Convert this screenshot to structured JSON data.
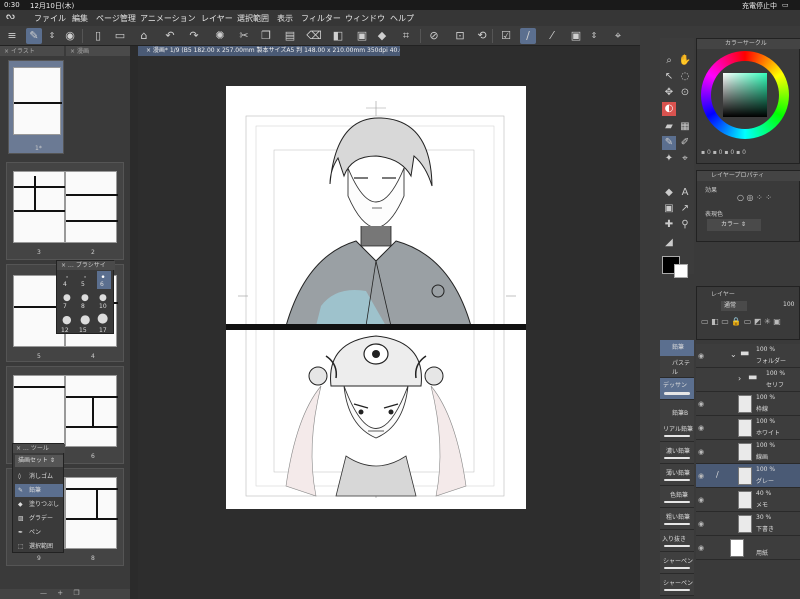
{
  "statusbar": {
    "time": "0:30",
    "date": "12月10日(木)",
    "battery": "充電停止中"
  },
  "menu": [
    "ファイル",
    "編集",
    "ページ管理",
    "アニメーション",
    "レイヤー",
    "選択範囲",
    "表示",
    "フィルター",
    "ウィンドウ",
    "ヘルプ"
  ],
  "pages_panel": {
    "header": "イラスト",
    "header2": "漫画",
    "pages": [
      {
        "label": "1*",
        "selected": true
      },
      {
        "label_left": "3",
        "label_right": "2"
      },
      {
        "label_left": "5",
        "label_right": "4"
      },
      {
        "label_left": "7",
        "label_right": "6"
      },
      {
        "label_left": "9",
        "label_right": "8"
      }
    ]
  },
  "canvas_tab": "× 漫画* 1/9 (B5 182.00 x 257.00mm 製本サイズA5 判 148.00 x 210.00mm 350dpi 40.6%)",
  "brush_size_popup": {
    "title": "ブラシサイ",
    "sizes": [
      "4",
      "5",
      "6",
      "7",
      "8",
      "10",
      "12",
      "15",
      "17"
    ],
    "selected": "6"
  },
  "tool_popup": {
    "title": "ツール",
    "set_label": "描画セット",
    "items": [
      "消しゴム",
      "鉛筆",
      "塗りつぶし",
      "グラデー",
      "ペン",
      "選択範囲"
    ]
  },
  "color_panel": {
    "title": "カラーサークル"
  },
  "layer_property": {
    "title": "レイヤープロパティ",
    "effect": "効果",
    "express_color": "表現色",
    "color_mode": "カラー"
  },
  "layer_panel": {
    "title": "レイヤー",
    "blend": "通常",
    "opacity": "100",
    "layers": [
      {
        "pct": "100 %",
        "name": "フォルダー"
      },
      {
        "pct": "100 %",
        "name": "セリフ"
      },
      {
        "pct": "100 %",
        "name": "枠線"
      },
      {
        "pct": "100 %",
        "name": "ホワイト"
      },
      {
        "pct": "100 %",
        "name": "線画"
      },
      {
        "pct": "100 %",
        "name": "グレー",
        "selected": true
      },
      {
        "pct": "40 %",
        "name": "メモ"
      },
      {
        "pct": "30 %",
        "name": "下書き"
      },
      {
        "pct": "",
        "name": "用紙"
      }
    ]
  },
  "brushes": [
    "鉛筆",
    "パステル",
    "デッサン",
    "鉛筆B",
    "リアル鉛筆",
    "濃い鉛筆",
    "薄い鉛筆",
    "色鉛筆",
    "粗い鉛筆",
    "入り抜き",
    "シャーペン",
    "シャーペン"
  ],
  "colors": {
    "accent": "#5b6f8f",
    "selection": "#4a5a75",
    "panel": "#3a3a3a",
    "canvas_bg": "#2d2d2d"
  }
}
